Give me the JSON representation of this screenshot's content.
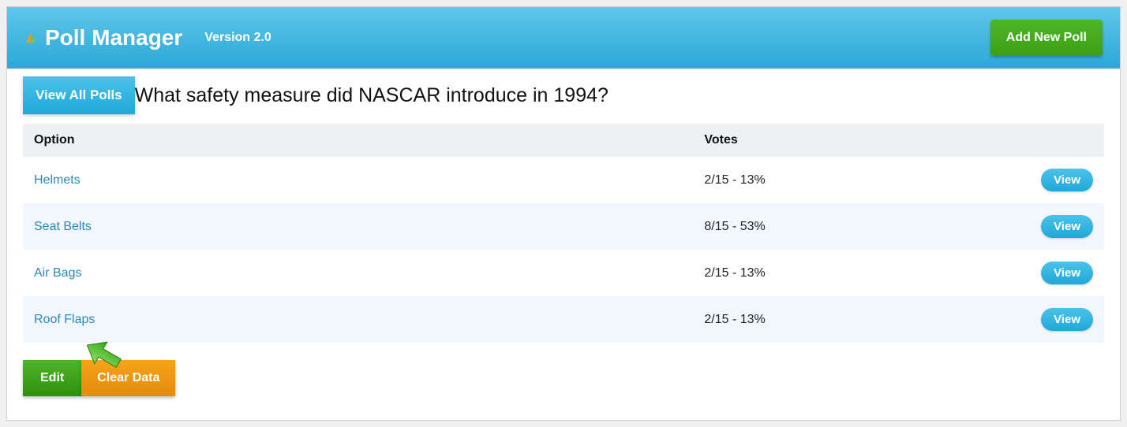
{
  "header": {
    "title": "Poll Manager",
    "version": "Version 2.0",
    "add_new_label": "Add New Poll"
  },
  "subheader": {
    "view_all_label": "View All Polls",
    "question": "What safety measure did NASCAR introduce in 1994?"
  },
  "table": {
    "headers": {
      "option": "Option",
      "votes": "Votes"
    },
    "view_label": "View",
    "rows": [
      {
        "option": "Helmets",
        "votes": "2/15 - 13%"
      },
      {
        "option": "Seat Belts",
        "votes": "8/15 - 53%"
      },
      {
        "option": "Air Bags",
        "votes": "2/15 - 13%"
      },
      {
        "option": "Roof Flaps",
        "votes": "2/15 - 13%"
      }
    ]
  },
  "actions": {
    "edit_label": "Edit",
    "clear_label": "Clear Data"
  }
}
